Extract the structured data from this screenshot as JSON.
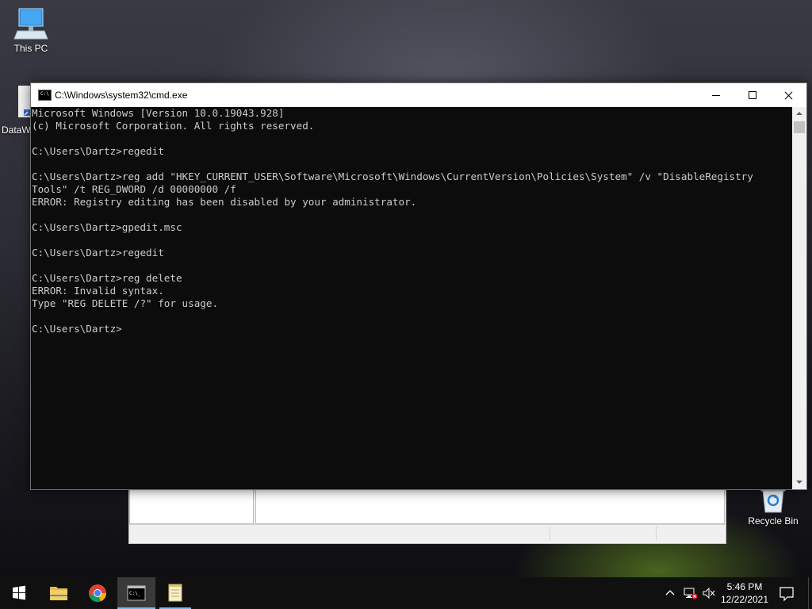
{
  "desktop": {
    "icons": [
      {
        "label": "This PC",
        "icon": "this-pc-icon"
      },
      {
        "label": "DataW",
        "icon": "shortcut-icon"
      },
      {
        "label": "Recycle Bin",
        "icon": "recycle-bin-icon"
      }
    ]
  },
  "cmd_window": {
    "title": "C:\\Windows\\system32\\cmd.exe",
    "controls": {
      "minimize": "minimize-icon",
      "maximize": "maximize-icon",
      "close": "close-icon"
    },
    "console_lines": [
      "Microsoft Windows [Version 10.0.19043.928]",
      "(c) Microsoft Corporation. All rights reserved.",
      "",
      "C:\\Users\\Dartz>regedit",
      "",
      "C:\\Users\\Dartz>reg add \"HKEY_CURRENT_USER\\Software\\Microsoft\\Windows\\CurrentVersion\\Policies\\System\" /v \"DisableRegistry",
      "Tools\" /t REG_DWORD /d 00000000 /f",
      "ERROR: Registry editing has been disabled by your administrator.",
      "",
      "C:\\Users\\Dartz>gpedit.msc",
      "",
      "C:\\Users\\Dartz>regedit",
      "",
      "C:\\Users\\Dartz>reg delete",
      "ERROR: Invalid syntax.",
      "Type \"REG DELETE /?\" for usage.",
      "",
      "C:\\Users\\Dartz>"
    ],
    "colors": {
      "background": "#0c0c0c",
      "text": "#cccccc"
    }
  },
  "taskbar": {
    "items": [
      {
        "name": "start",
        "icon": "windows-logo-icon"
      },
      {
        "name": "file-explorer",
        "icon": "folder-icon"
      },
      {
        "name": "chrome",
        "icon": "chrome-icon"
      },
      {
        "name": "command-prompt",
        "icon": "cmd-icon",
        "active": true
      },
      {
        "name": "notepad",
        "icon": "notepad-icon"
      }
    ],
    "tray": {
      "chevron": "chevron-up-icon",
      "network": "network-icon",
      "volume": "volume-muted-icon"
    },
    "clock": {
      "time": "5:46 PM",
      "date": "12/22/2021"
    },
    "notifications": "notification-icon",
    "accent": "#76b9ed"
  }
}
